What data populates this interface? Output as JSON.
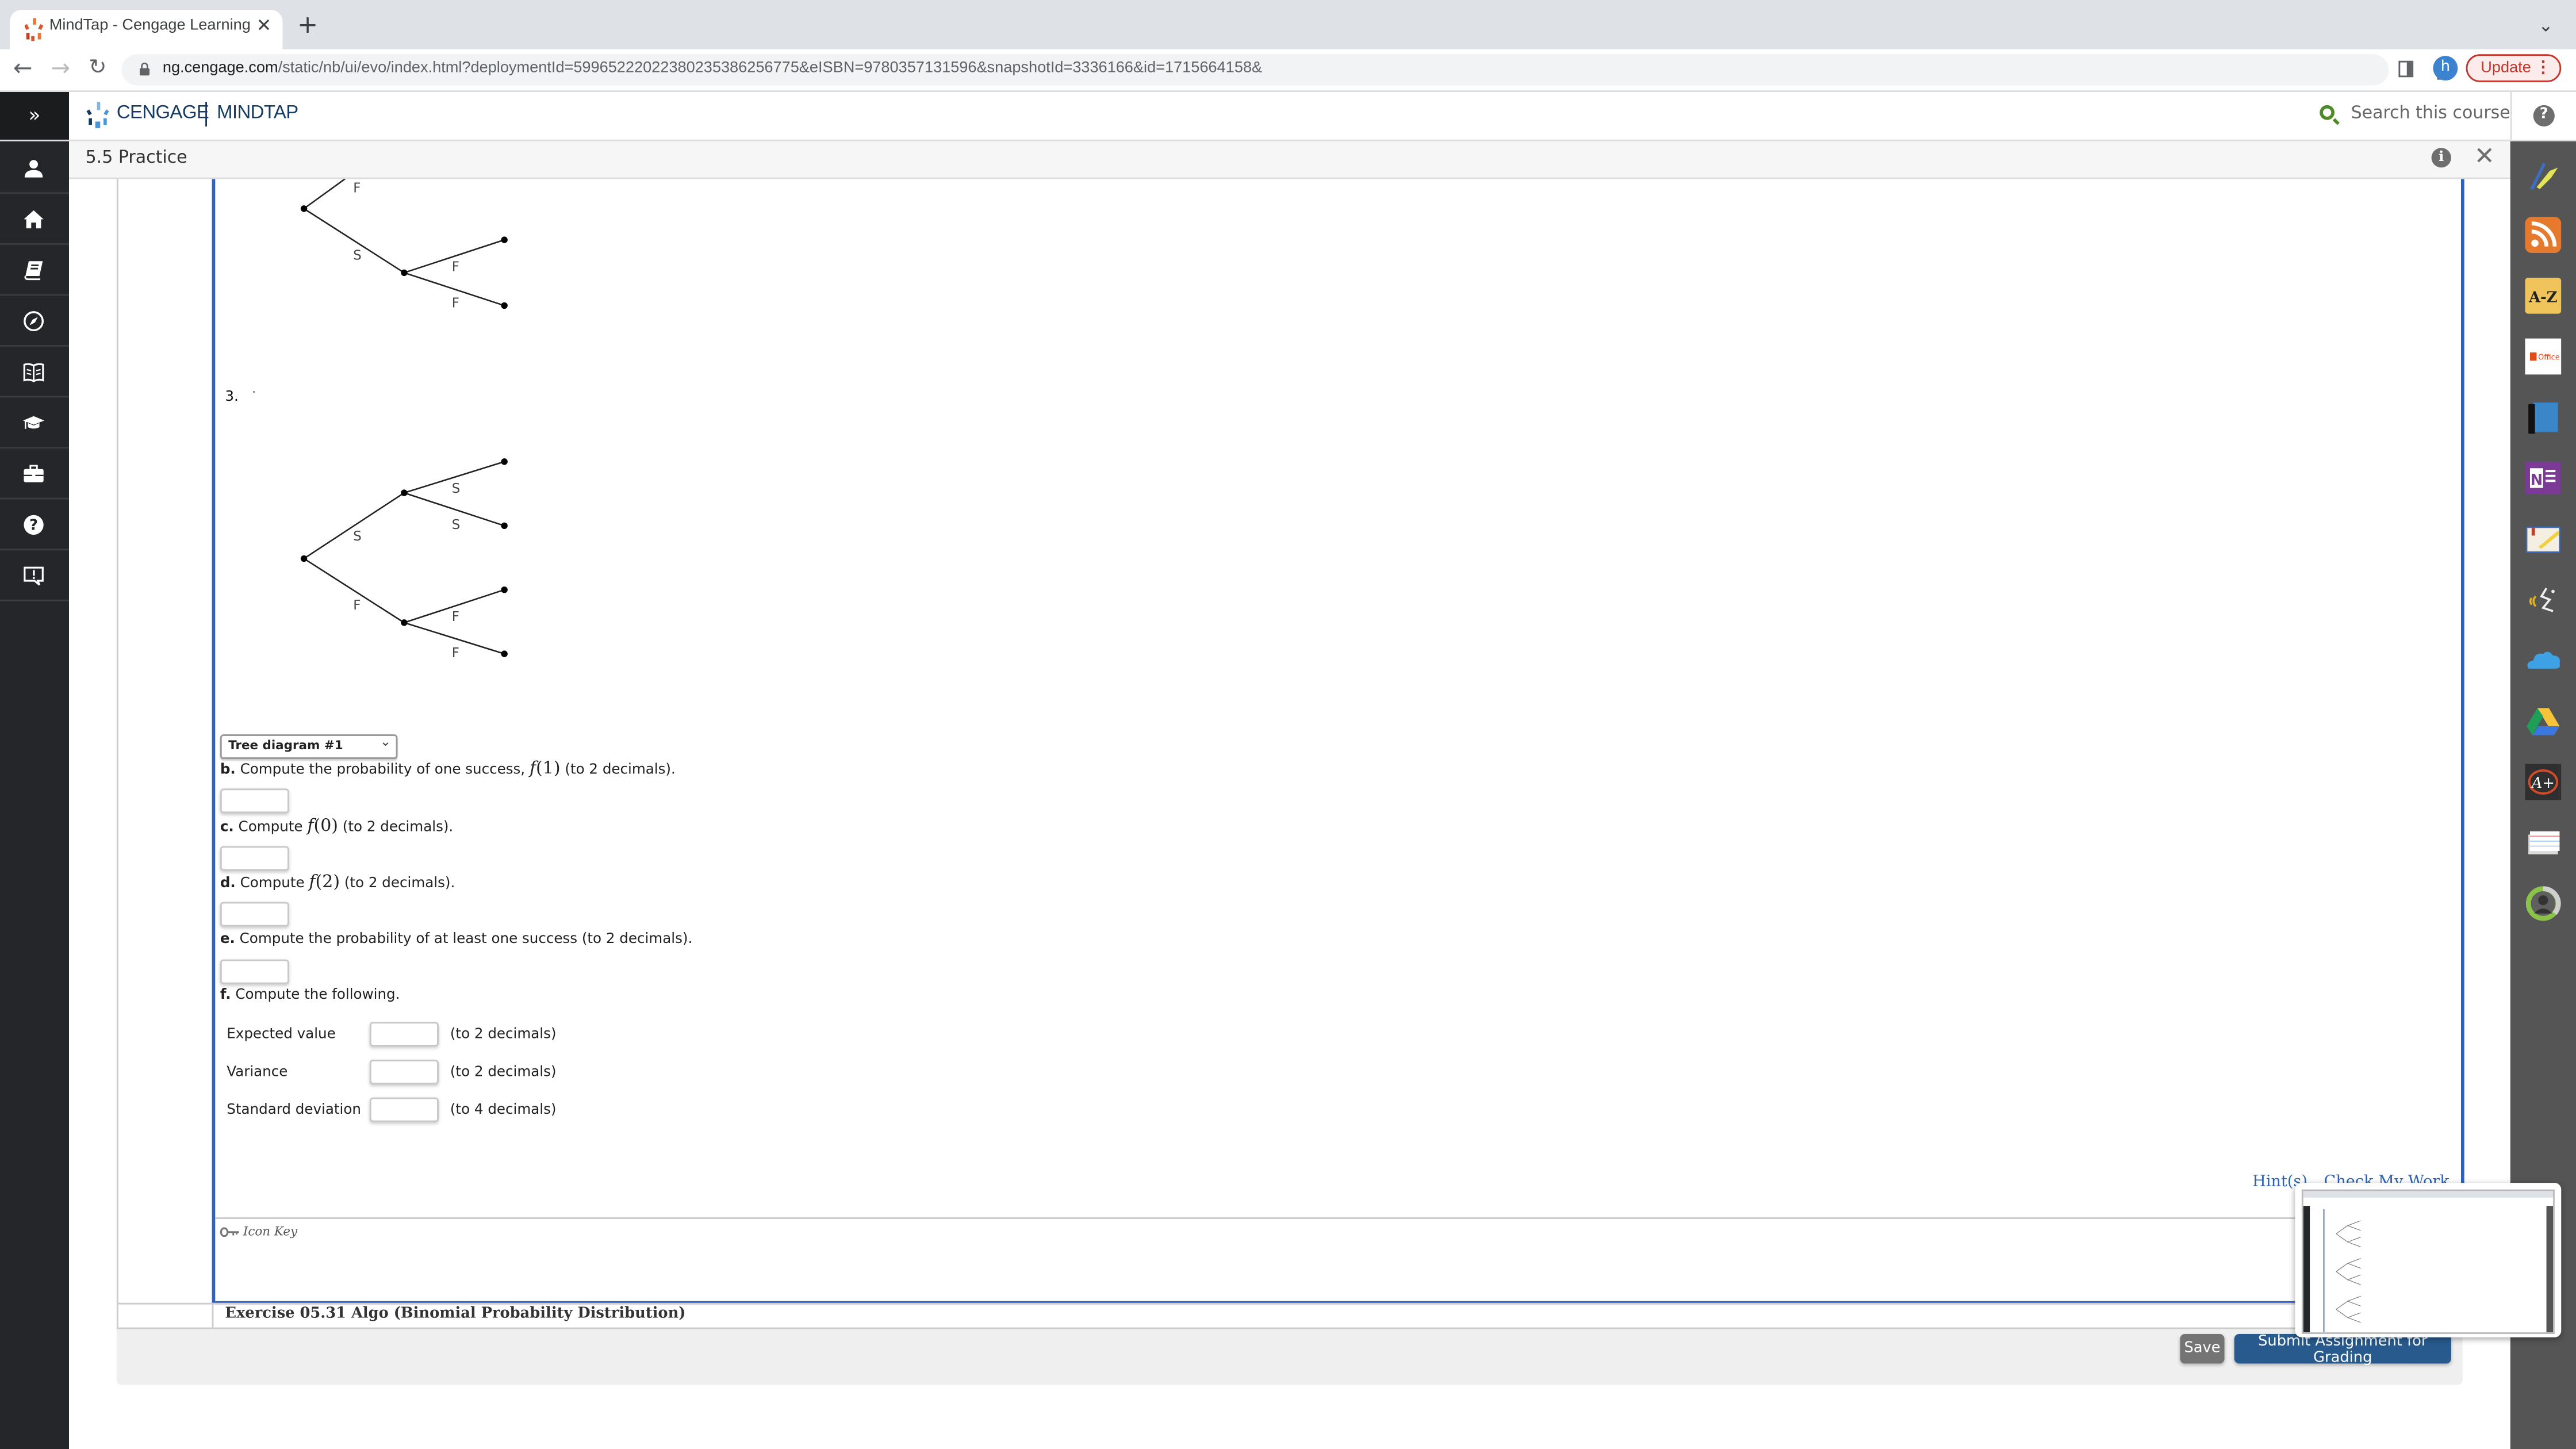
{
  "browser": {
    "tab_title": "MindTap - Cengage Learning",
    "tab_close": "✕",
    "new_tab": "+",
    "url_host": "ng.cengage.com",
    "url_path": "/static/nb/ui/evo/index.html?deploymentId=59965222022380235386256775&eISBN=9780357131596&snapshotId=3336166&id=1715664158&",
    "profile_initial": "h",
    "update_label": "Update",
    "icons": [
      "back-arrow-icon",
      "forward-arrow-icon",
      "reload-icon",
      "lock-icon",
      "share-icon",
      "bookmark-star-icon",
      "side-panel-icon",
      "kebab-menu-icon",
      "tab-list-chevron-icon"
    ]
  },
  "app_header": {
    "brand_left": "CENGAGE",
    "brand_right": "MINDTAP",
    "search_label": "Search this course",
    "rail_toggle": "»"
  },
  "practice_bar": {
    "title": "5.5 Practice"
  },
  "left_rail": {
    "items": [
      {
        "name": "profile",
        "icon": "user-icon"
      },
      {
        "name": "home",
        "icon": "home-icon"
      },
      {
        "name": "readings",
        "icon": "book-icon"
      },
      {
        "name": "explore",
        "icon": "compass-icon"
      },
      {
        "name": "ebook",
        "icon": "open-book-icon"
      },
      {
        "name": "courses",
        "icon": "graduation-cap-icon"
      },
      {
        "name": "career",
        "icon": "briefcase-icon"
      },
      {
        "name": "help",
        "icon": "question-circle-icon"
      },
      {
        "name": "feedback",
        "icon": "feedback-icon"
      }
    ]
  },
  "right_rail": {
    "tools": [
      {
        "name": "highlighter",
        "icon": "highlighter-icon"
      },
      {
        "name": "rss",
        "icon": "rss-icon"
      },
      {
        "name": "glossary",
        "icon": "a-z-icon"
      },
      {
        "name": "office",
        "icon": "office-icon",
        "label": "Office"
      },
      {
        "name": "flashcards-book",
        "icon": "book-blue-icon"
      },
      {
        "name": "onenote",
        "icon": "onenote-icon"
      },
      {
        "name": "notes",
        "icon": "notebook-icon"
      },
      {
        "name": "readspeaker",
        "icon": "readspeaker-icon"
      },
      {
        "name": "onedrive",
        "icon": "onedrive-icon"
      },
      {
        "name": "google-drive",
        "icon": "google-drive-icon"
      },
      {
        "name": "aplia",
        "icon": "a-plus-icon",
        "label": "A+"
      },
      {
        "name": "index-cards",
        "icon": "index-cards-icon"
      },
      {
        "name": "progress",
        "icon": "progress-ring-icon"
      }
    ]
  },
  "question": {
    "tree_option_number": "3.",
    "tree_partial_top": {
      "branches": [
        "F",
        "S",
        "F",
        "F"
      ]
    },
    "tree_3": {
      "first_level": [
        "S",
        "F"
      ],
      "second_level_upper": [
        "S",
        "S"
      ],
      "second_level_lower": [
        "F",
        "F"
      ]
    },
    "tree_select": {
      "selected": "Tree diagram #1"
    },
    "parts": [
      {
        "letter": "b.",
        "text_before": "Compute the probability of one success,",
        "math_fn": "f",
        "math_arg": "(1)",
        "text_after": "(to 2 decimals).",
        "value": ""
      },
      {
        "letter": "c.",
        "text_before": "Compute",
        "math_fn": "f",
        "math_arg": "(0)",
        "text_after": "(to 2 decimals).",
        "value": ""
      },
      {
        "letter": "d.",
        "text_before": "Compute",
        "math_fn": "f",
        "math_arg": "(2)",
        "text_after": "(to 2 decimals).",
        "value": ""
      },
      {
        "letter": "e.",
        "text_before": "Compute the probability of at least one success (to 2 decimals).",
        "value": ""
      }
    ],
    "part_f": {
      "letter": "f.",
      "text": "Compute the following.",
      "rows": [
        {
          "label": "Expected value",
          "unit": "(to 2 decimals)",
          "value": ""
        },
        {
          "label": "Variance",
          "unit": "(to 2 decimals)",
          "value": ""
        },
        {
          "label": "Standard deviation",
          "unit": "(to 4 decimals)",
          "value": ""
        }
      ]
    },
    "hints_label": "Hint(s)",
    "check_label": "Check My Work",
    "icon_key_label": "Icon Key"
  },
  "exercise": {
    "title": "Exercise 05.31 Algo (Binomial Probability Distribution)"
  },
  "footer": {
    "save_label": "Save",
    "submit_label": "Submit Assignment for Grading"
  },
  "colors": {
    "frame_blue": "#2c62c6",
    "submit_blue": "#285a8d",
    "save_gray": "#747474",
    "update_red": "#c5352b",
    "search_green": "#4c8b26",
    "brand_navy": "#153a63"
  }
}
